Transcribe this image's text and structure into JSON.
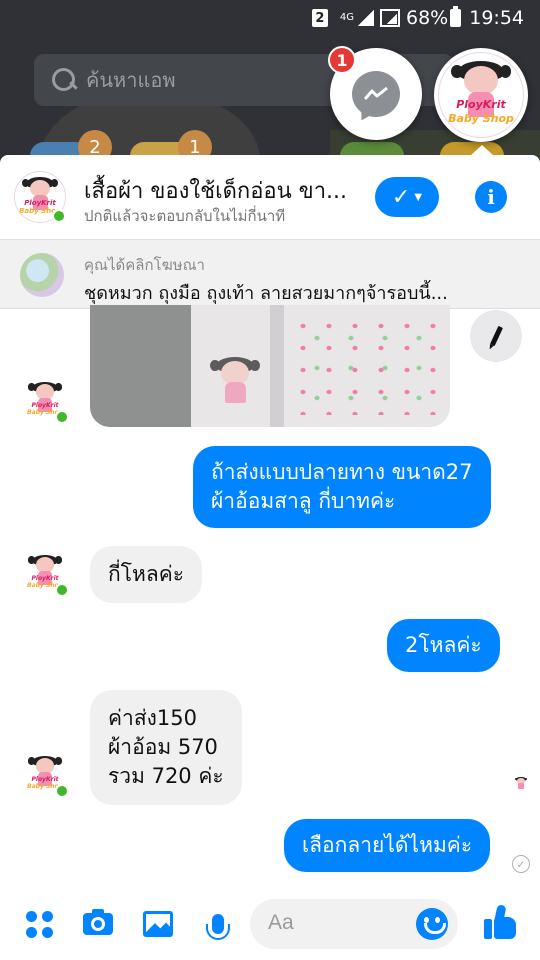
{
  "status_bar": {
    "sim": "2",
    "network": "4G",
    "battery": "68%",
    "time": "19:54"
  },
  "home": {
    "search_placeholder": "ค้นหาแอพ",
    "badges": [
      "2",
      "1"
    ]
  },
  "chat_heads": {
    "unread_count": "1"
  },
  "logo": {
    "line1": "PloyKrit",
    "line2": "Baby Shop"
  },
  "header": {
    "title": "เสื้อผ้า ของใช้เด็กอ่อน ขา...",
    "subtitle": "ปกติแล้วจะตอบกลับในไม่กี่นาที"
  },
  "ad": {
    "label": "คุณได้คลิกโฆษณา",
    "text": "ชุดหมวก ถุงมือ ถุงเท้า ลายสวยมากๆจ้ารอบนี้..."
  },
  "messages": [
    {
      "from": "me",
      "lines": [
        "ถ้าส่งแบบปลายทาง ขนาด27",
        "ผ้าอ้อมสาลู กี่บาทค่ะ"
      ]
    },
    {
      "from": "shop",
      "lines": [
        "กี่โหลค่ะ"
      ]
    },
    {
      "from": "me",
      "lines": [
        "2โหลค่ะ"
      ]
    },
    {
      "from": "shop",
      "lines": [
        "ค่าส่ง150",
        "ผ้าอ้อม 570",
        "รวม 720 ค่ะ"
      ]
    },
    {
      "from": "me",
      "lines": [
        "เลือกลายได้ไหมค่ะ"
      ]
    }
  ],
  "composer": {
    "placeholder": "Aa"
  },
  "colors": {
    "accent": "#0084ff",
    "online": "#42b72a",
    "badge": "#e53935"
  }
}
